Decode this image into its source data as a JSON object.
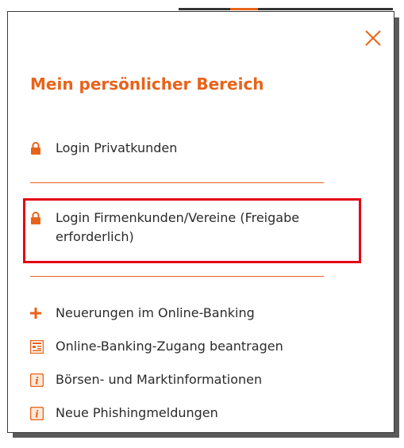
{
  "panel": {
    "title": "Mein persönlicher Bereich",
    "close_icon": "close-icon",
    "items": [
      {
        "label": "Login Privatkunden",
        "icon": "lock-icon"
      },
      {
        "label": "Login Firmenkunden/Vereine (Freigabe erforderlich)",
        "icon": "lock-icon",
        "highlighted": true
      },
      {
        "label": "Neuerungen im Online-Banking",
        "icon": "plus-icon"
      },
      {
        "label": "Online-Banking-Zugang beantragen",
        "icon": "form-icon"
      },
      {
        "label": "Börsen- und Marktinformationen",
        "icon": "info-icon"
      },
      {
        "label": "Neue Phishingmeldungen",
        "icon": "info-icon"
      }
    ]
  },
  "colors": {
    "accent": "#e8631a",
    "text": "#2b2b2b",
    "highlight": "#e30613"
  }
}
